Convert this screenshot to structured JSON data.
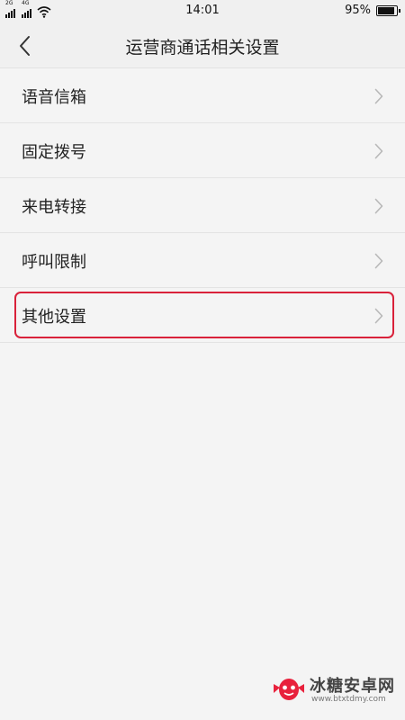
{
  "status_bar": {
    "sim1_tag": "2G",
    "sim2_tag": "4G",
    "time": "14:01",
    "battery_text": "95%",
    "battery_level": 0.95
  },
  "header": {
    "back_icon": "chevron-left-icon",
    "title": "运营商通话相关设置"
  },
  "items": [
    {
      "label": "语音信箱",
      "icon": "chevron-right-icon"
    },
    {
      "label": "固定拨号",
      "icon": "chevron-right-icon"
    },
    {
      "label": "来电转接",
      "icon": "chevron-right-icon"
    },
    {
      "label": "呼叫限制",
      "icon": "chevron-right-icon"
    },
    {
      "label": "其他设置",
      "icon": "chevron-right-icon",
      "highlighted": true
    }
  ],
  "watermark": {
    "name": "冰糖安卓网",
    "url": "www.btxtdmy.com"
  },
  "colors": {
    "highlight_border": "#d9213a",
    "background": "#f4f4f4"
  }
}
